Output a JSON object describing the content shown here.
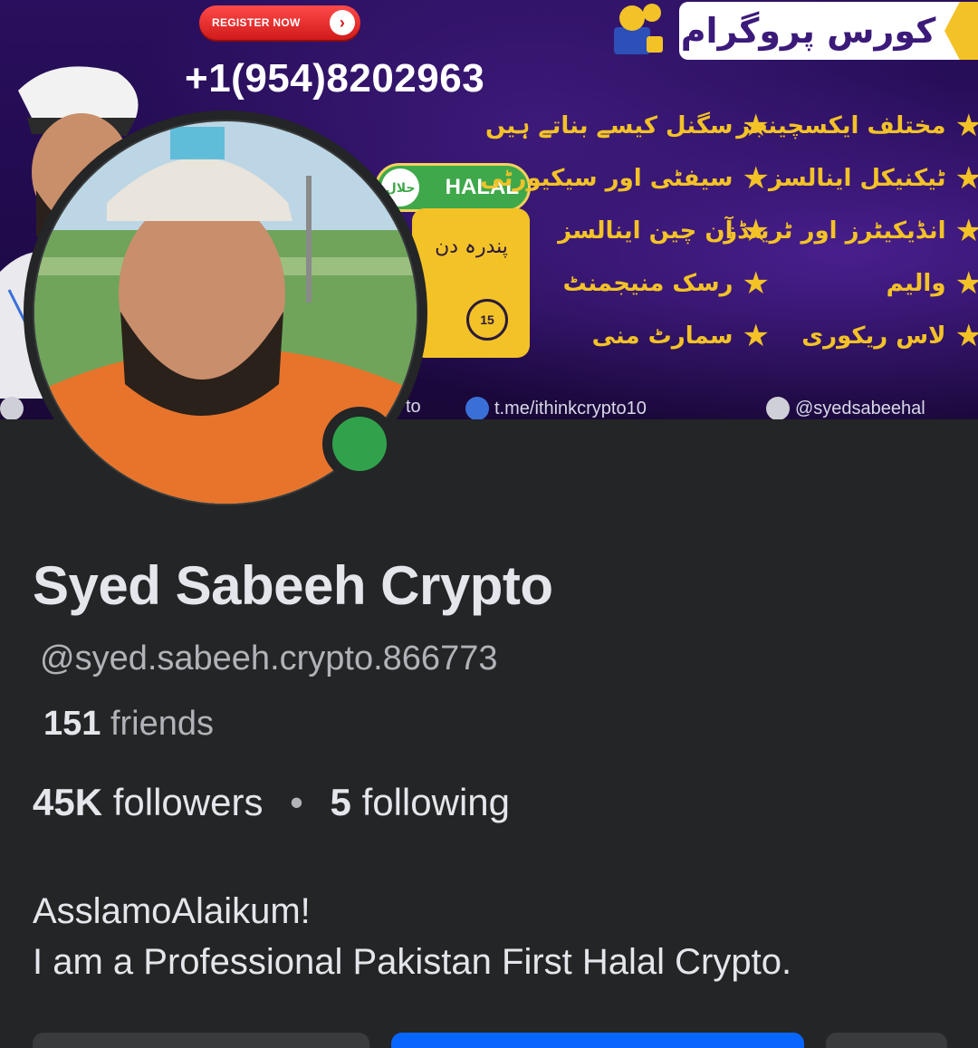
{
  "cover": {
    "register_label": "REGISTER NOW",
    "phone": "+1(954)8202963",
    "course_title": "کورس پروگرام",
    "halal_badge": "HALAL",
    "halal_seal": "حلال",
    "yellow_box_text": "پندرہ دن",
    "clock_number": "15",
    "features_col1": [
      "سگنل کیسے بناتے ہیں",
      "سیفٹی اور سیکیورٹی",
      "آن چین اینالسز",
      "رسک منیجمنٹ",
      "سمارٹ منی"
    ],
    "features_col2": [
      "مختلف ایکسچینجز",
      "ٹیکنیکل اینالسز",
      "انڈیکیٹرز اور ٹرینڈز",
      "والیم",
      "لاس ریکوری"
    ],
    "social_links": [
      "to",
      "t.me/ithinkcrypto10",
      "@syedsabeehal"
    ],
    "colors": {
      "purple": "#2a0f5e",
      "gold": "#f3c227",
      "green": "#3fa84a"
    }
  },
  "profile": {
    "name": "Syed Sabeeh Crypto",
    "username": "@syed.sabeeh.crypto.866773",
    "friends_count": "151",
    "friends_label": "friends",
    "followers_count": "45K",
    "followers_label": "followers",
    "following_count": "5",
    "following_label": "following",
    "separator": "•",
    "bio_line1": "AsslamoAlaikum!",
    "bio_line2": "I am a Professional Pakistan First Halal Crypto.",
    "online_status": "online",
    "colors": {
      "background": "#242526",
      "text": "#e4e6eb",
      "muted": "#b0b3b8",
      "online": "#31a24c",
      "primary": "#0866ff"
    }
  },
  "icons": [
    "star-icon",
    "arrow-right-icon",
    "clock-icon",
    "telegram-icon",
    "x-icon",
    "search-icon",
    "trophy-icon"
  ]
}
